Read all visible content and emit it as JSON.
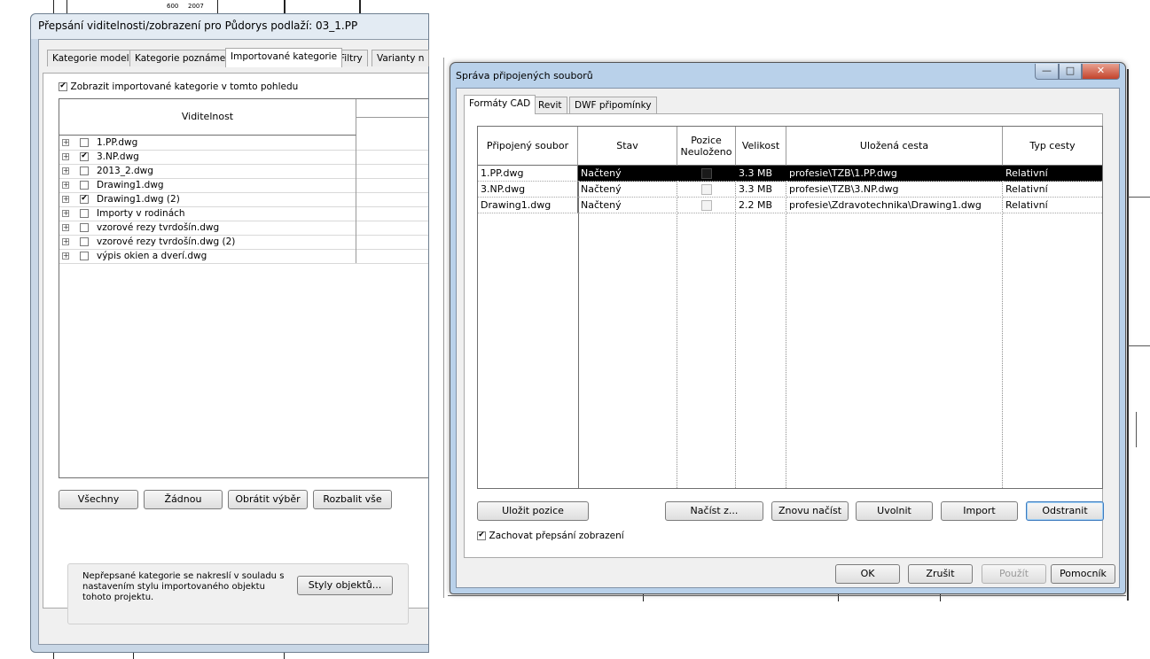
{
  "background": {
    "cad_labels": [
      "600",
      "2007"
    ]
  },
  "vg_dialog": {
    "title": "Přepsání viditelnosti/zobrazení pro Půdorys podlaží: 03_1.PP",
    "tabs": [
      "Kategorie modelů",
      "Kategorie poznámek",
      "Importované kategorie",
      "Filtry",
      "Varianty n"
    ],
    "active_tab": "Importované kategorie",
    "show_imported_label": "Zobrazit importované kategorie v tomto pohledu",
    "show_imported_checked": true,
    "column_header": "Viditelnost",
    "rows": [
      {
        "label": "1.PP.dwg",
        "checked": false
      },
      {
        "label": "3.NP.dwg",
        "checked": true
      },
      {
        "label": "2013_2.dwg",
        "checked": false
      },
      {
        "label": "Drawing1.dwg",
        "checked": false
      },
      {
        "label": "Drawing1.dwg (2)",
        "checked": true
      },
      {
        "label": "Importy v rodinách",
        "checked": false
      },
      {
        "label": "vzorové rezy tvrdošín.dwg",
        "checked": false
      },
      {
        "label": "vzorové rezy tvrdošín.dwg (2)",
        "checked": false
      },
      {
        "label": "výpis okien a dverí.dwg",
        "checked": false
      }
    ],
    "buttons": {
      "all": "Všechny",
      "none": "Žádnou",
      "invert": "Obrátit výběr",
      "expand": "Rozbalit vše",
      "object_styles": "Styly objektů..."
    },
    "note": "Nepřepsané kategorie se nakreslí v souladu s nastavením stylu importovaného objektu tohoto projektu."
  },
  "lm_dialog": {
    "title": "Správa připojených souborů",
    "window_buttons": {
      "minimize": "—",
      "maximize": "□",
      "close": "✕"
    },
    "tabs": [
      "Formáty CAD",
      "Revit",
      "DWF připomínky"
    ],
    "active_tab": "Formáty CAD",
    "columns": [
      "Připojený soubor",
      "Stav",
      "Pozice Neuloženo",
      "Velikost",
      "Uložená cesta",
      "Typ cesty"
    ],
    "rows": [
      {
        "file": "1.PP.dwg",
        "status": "Načtený",
        "unsaved": false,
        "size": "3.3 MB",
        "path": "profesie\\TZB\\1.PP.dwg",
        "path_type": "Relativní",
        "selected": true
      },
      {
        "file": "3.NP.dwg",
        "status": "Načtený",
        "unsaved": false,
        "size": "3.3 MB",
        "path": "profesie\\TZB\\3.NP.dwg",
        "path_type": "Relativní",
        "selected": false
      },
      {
        "file": "Drawing1.dwg",
        "status": "Načtený",
        "unsaved": false,
        "size": "2.2 MB",
        "path": "profesie\\Zdravotechnika\\Drawing1.dwg",
        "path_type": "Relativní",
        "selected": false
      }
    ],
    "buttons": {
      "save_positions": "Uložit pozice",
      "reload_from": "Načíst z...",
      "reload": "Znovu načíst",
      "unload": "Uvolnit",
      "import": "Import",
      "remove": "Odstranit",
      "ok": "OK",
      "cancel": "Zrušit",
      "apply": "Použít",
      "help": "Pomocník"
    },
    "keep_overrides_label": "Zachovat přepsání zobrazení",
    "keep_overrides_checked": true
  }
}
